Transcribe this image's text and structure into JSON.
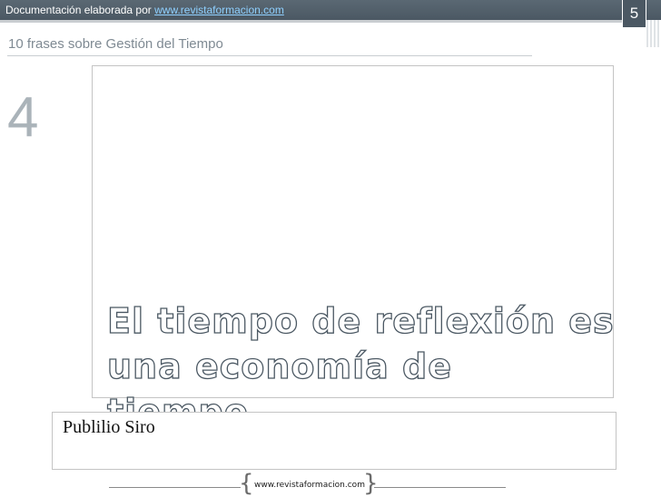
{
  "header": {
    "prefix": "Documentación elaborada por ",
    "link": "www.revistaformacion.com",
    "slide_number": "5"
  },
  "subtitle": "10 frases sobre Gestión del Tiempo",
  "quote": {
    "number": "4",
    "line1": "El tiempo de reflexión es",
    "line2": "una economía de tiempo.",
    "author": "Publilio Siro"
  },
  "footer": {
    "brace_open": "{",
    "url": "www.revistaformacion.com",
    "brace_close": "}"
  },
  "colors": {
    "header_bg": "#4b5863",
    "link": "#8fd0ff",
    "quote_outline": "#4b5863"
  }
}
